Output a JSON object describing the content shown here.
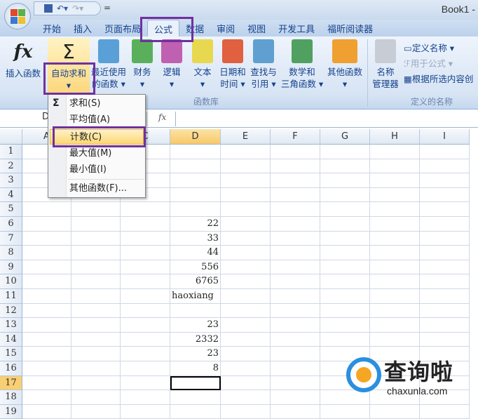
{
  "window": {
    "title": "Book1 -"
  },
  "qat": {
    "save_icon": "save-icon",
    "undo_icon": "undo-icon",
    "redo_icon": "redo-icon",
    "customize": "="
  },
  "tabs": [
    {
      "label": "开始"
    },
    {
      "label": "插入"
    },
    {
      "label": "页面布局"
    },
    {
      "label": "公式",
      "active": true
    },
    {
      "label": "数据"
    },
    {
      "label": "审阅"
    },
    {
      "label": "视图"
    },
    {
      "label": "开发工具"
    },
    {
      "label": "福昕阅读器"
    }
  ],
  "ribbon": {
    "insert_function": {
      "label": "插入函数",
      "icon": "fx"
    },
    "autosum": {
      "label": "自动求和",
      "icon": "Σ",
      "arrow": "▾"
    },
    "library": [
      {
        "label": "最近使用",
        "label2": "的函数 ▾",
        "color": "#5aa0d8"
      },
      {
        "label": "财务",
        "label2": "▾",
        "color": "#5ab05a"
      },
      {
        "label": "逻辑",
        "label2": "▾",
        "color": "#c060b0"
      },
      {
        "label": "文本",
        "label2": "▾",
        "color": "#e8d850"
      },
      {
        "label": "日期和",
        "label2": "时间 ▾",
        "color": "#e06040"
      },
      {
        "label": "查找与",
        "label2": "引用 ▾",
        "color": "#60a0d0"
      },
      {
        "label": "数学和",
        "label2": "三角函数 ▾",
        "color": "#50a060"
      },
      {
        "label": "其他函数",
        "label2": "▾",
        "color": "#f0a030"
      }
    ],
    "library_group": "函数库",
    "name_manager": {
      "label": "名称",
      "label2": "管理器"
    },
    "define_name": "定义名称 ▾",
    "use_in_formula": "用于公式 ▾",
    "create_from_selection": "根据所选内容创",
    "names_group": "定义的名称"
  },
  "formula_bar": {
    "name_box": "D",
    "fx": "fx"
  },
  "menu": {
    "items": [
      {
        "label": "求和(S)",
        "icon": "Σ"
      },
      {
        "label": "平均值(A)"
      },
      {
        "label": "计数(C)",
        "active": true
      },
      {
        "label": "最大值(M)"
      },
      {
        "label": "最小值(I)"
      },
      {
        "label": "其他函数(F)..."
      }
    ]
  },
  "sheet": {
    "columns": [
      "A",
      "B",
      "C",
      "D",
      "E",
      "F",
      "G",
      "H",
      "I"
    ],
    "selected_column": "D",
    "selected_row": 17,
    "rows": [
      "1",
      "2",
      "3",
      "4",
      "5",
      "6",
      "7",
      "8",
      "9",
      "10",
      "11",
      "12",
      "13",
      "14",
      "15",
      "16",
      "17",
      "18",
      "19"
    ],
    "column_d": {
      "6": "22",
      "7": "33",
      "8": "44",
      "9": "556",
      "10": "6765",
      "11": "haoxiang",
      "13": "23",
      "14": "2332",
      "15": "23",
      "16": "8"
    }
  },
  "watermark": {
    "name": "查询啦",
    "url": "chaxunla.com"
  },
  "colors": {
    "highlight": "#7030a0",
    "selected": "#f8c869"
  }
}
